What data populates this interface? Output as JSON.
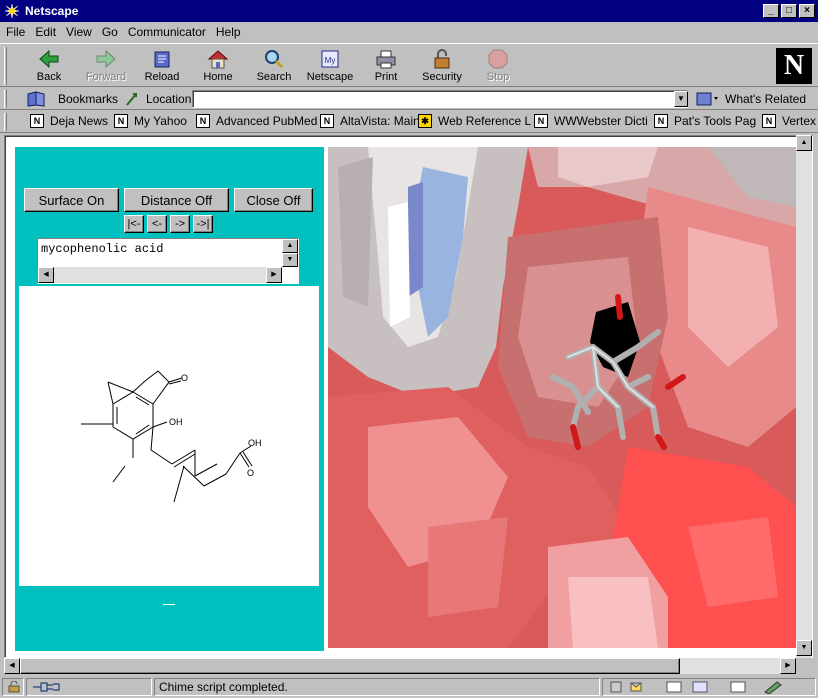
{
  "window": {
    "title": "Netscape"
  },
  "menu": [
    "File",
    "Edit",
    "View",
    "Go",
    "Communicator",
    "Help"
  ],
  "toolbar": {
    "back": "Back",
    "forward": "Forward",
    "reload": "Reload",
    "home": "Home",
    "search": "Search",
    "netscape": "Netscape",
    "print": "Print",
    "security": "Security",
    "stop": "Stop"
  },
  "location": {
    "bookmarks_label": "Bookmarks",
    "location_label": "Location:",
    "url": "",
    "whats_related": "What's Related"
  },
  "personal_toolbar": [
    "Deja News",
    "My Yahoo",
    "Advanced PubMed",
    "AltaVista: Main",
    "Web Reference L",
    "WWWebster Dicti",
    "Pat's Tools Pag",
    "Vertex"
  ],
  "left_frame": {
    "surface_button": "Surface On",
    "distance_button": "Distance Off",
    "close_button": "Close Off",
    "nav": {
      "first": "|<-",
      "prev": "<-",
      "next": "->",
      "last": "->|"
    },
    "molecule_name": "mycophenolic acid",
    "structure_labels": {
      "oh": "OH",
      "o": "O",
      "acid_oh": "OH",
      "acid_o": "O"
    }
  },
  "status": {
    "message": "Chime script completed."
  },
  "colors": {
    "frame_teal": "#00c0c0",
    "titlebar": "#000080",
    "chrome": "#c0c0c0"
  }
}
